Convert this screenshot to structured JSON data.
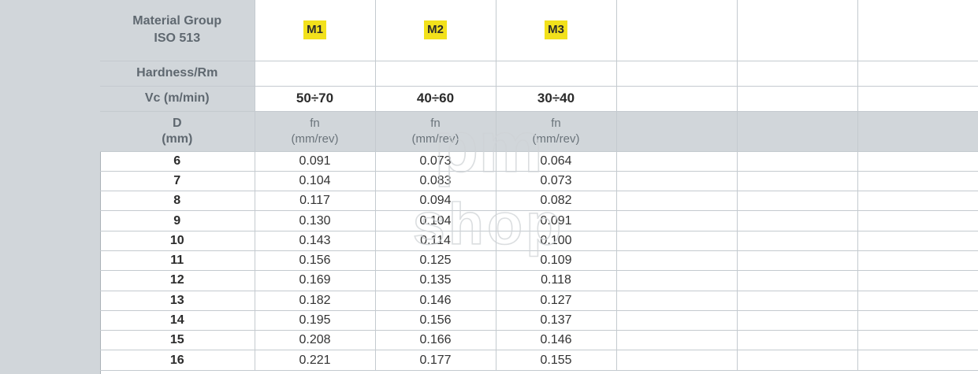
{
  "header": {
    "group_label_line1": "Material Group",
    "group_label_line2": "ISO 513",
    "hardness_label": "Hardness/Rm",
    "vc_label": "Vc (m/min)",
    "d_label_line1": "D",
    "d_label_line2": "(mm)"
  },
  "materials": [
    {
      "tag": "M1",
      "vc": "50÷70",
      "fn_line1": "fn",
      "fn_line2": "(mm/rev)"
    },
    {
      "tag": "M2",
      "vc": "40÷60",
      "fn_line1": "fn",
      "fn_line2": "(mm/rev)"
    },
    {
      "tag": "M3",
      "vc": "30÷40",
      "fn_line1": "fn",
      "fn_line2": "(mm/rev)"
    }
  ],
  "rows": [
    {
      "d": "6",
      "m1": "0.091",
      "m2": "0.073",
      "m3": "0.064"
    },
    {
      "d": "7",
      "m1": "0.104",
      "m2": "0.083",
      "m3": "0.073"
    },
    {
      "d": "8",
      "m1": "0.117",
      "m2": "0.094",
      "m3": "0.082"
    },
    {
      "d": "9",
      "m1": "0.130",
      "m2": "0.104",
      "m3": "0.091"
    },
    {
      "d": "10",
      "m1": "0.143",
      "m2": "0.114",
      "m3": "0.100"
    },
    {
      "d": "11",
      "m1": "0.156",
      "m2": "0.125",
      "m3": "0.109"
    },
    {
      "d": "12",
      "m1": "0.169",
      "m2": "0.135",
      "m3": "0.118"
    },
    {
      "d": "13",
      "m1": "0.182",
      "m2": "0.146",
      "m3": "0.127"
    },
    {
      "d": "14",
      "m1": "0.195",
      "m2": "0.156",
      "m3": "0.137"
    },
    {
      "d": "15",
      "m1": "0.208",
      "m2": "0.166",
      "m3": "0.146"
    },
    {
      "d": "16",
      "m1": "0.221",
      "m2": "0.177",
      "m3": "0.155"
    }
  ],
  "watermark": {
    "line1": "pm",
    "line2": "shop"
  },
  "colors": {
    "header_gray": "#d1d6da",
    "tag_yellow": "#f2e11c",
    "grid_line": "#c4cacf"
  }
}
